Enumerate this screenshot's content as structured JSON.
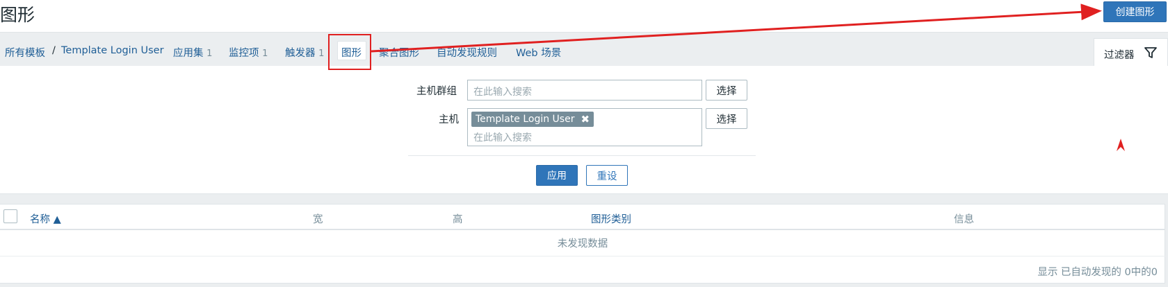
{
  "header": {
    "title": "图形",
    "create_button": "创建图形"
  },
  "nav": {
    "items": [
      {
        "label": "所有模板"
      },
      {
        "separator": "/"
      },
      {
        "label": "Template Login User"
      },
      {
        "label": "应用集",
        "count": "1"
      },
      {
        "label": "监控项",
        "count": "1"
      },
      {
        "label": "触发器",
        "count": "1"
      },
      {
        "label": "图形"
      },
      {
        "label": "聚合图形"
      },
      {
        "label": "自动发现规则"
      },
      {
        "label": "Web 场景"
      }
    ],
    "active_index": 6
  },
  "filter": {
    "tab_label": "过滤器",
    "icon": "funnel-icon",
    "host_group_label": "主机群组",
    "host_group_placeholder": "在此输入搜索",
    "host_label": "主机",
    "host_tag": "Template Login User",
    "host_placeholder": "在此输入搜索",
    "select_label": "选择",
    "apply_label": "应用",
    "reset_label": "重设"
  },
  "table": {
    "columns": [
      "名称 ▲",
      "宽",
      "高",
      "图形类别",
      "信息"
    ],
    "empty_text": "未发现数据",
    "footer": "显示 已自动发现的 0中的0"
  },
  "colors": {
    "primary": "#2f75b9",
    "annotation": "#e02020",
    "link": "#1f5e96"
  }
}
